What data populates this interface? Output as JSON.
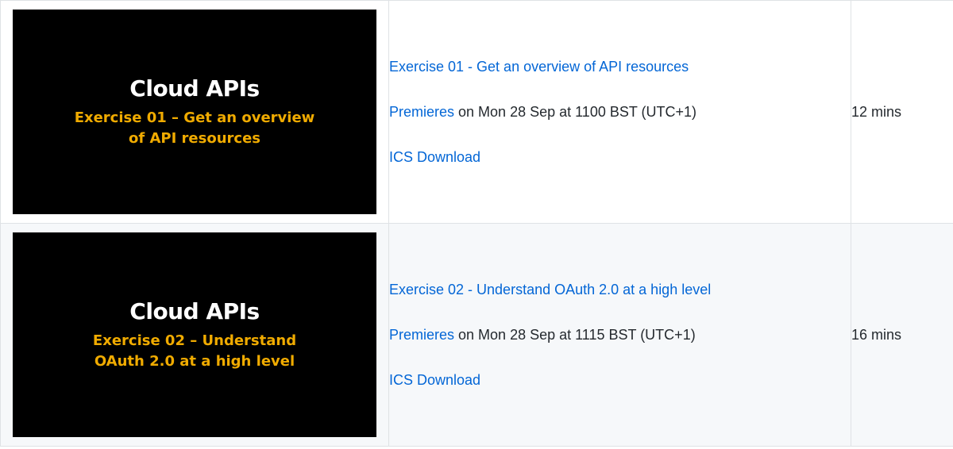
{
  "episodes": [
    {
      "thumb_title": "Cloud APIs",
      "thumb_sub": "Exercise 01 – Get an overview of API resources",
      "title_link": "Exercise 01 - Get an overview of API resources",
      "premieres_link": "Premieres",
      "schedule_text": " on Mon 28 Sep at 1100 BST (UTC+1)",
      "ics_link": "ICS Download",
      "duration": "12 mins"
    },
    {
      "thumb_title": "Cloud APIs",
      "thumb_sub": "Exercise 02 – Understand OAuth 2.0 at a high level",
      "title_link": "Exercise 02 - Understand OAuth 2.0 at a high level",
      "premieres_link": "Premieres",
      "schedule_text": " on Mon 28 Sep at 1115 BST (UTC+1)",
      "ics_link": "ICS Download",
      "duration": "16 mins"
    }
  ],
  "colors": {
    "link": "#0366d6",
    "text": "#24292e",
    "thumb_bg": "#000000",
    "thumb_title": "#ffffff",
    "thumb_sub": "#f0ab00",
    "row_alt_bg": "#f6f8fa",
    "border": "#dfe2e5"
  }
}
